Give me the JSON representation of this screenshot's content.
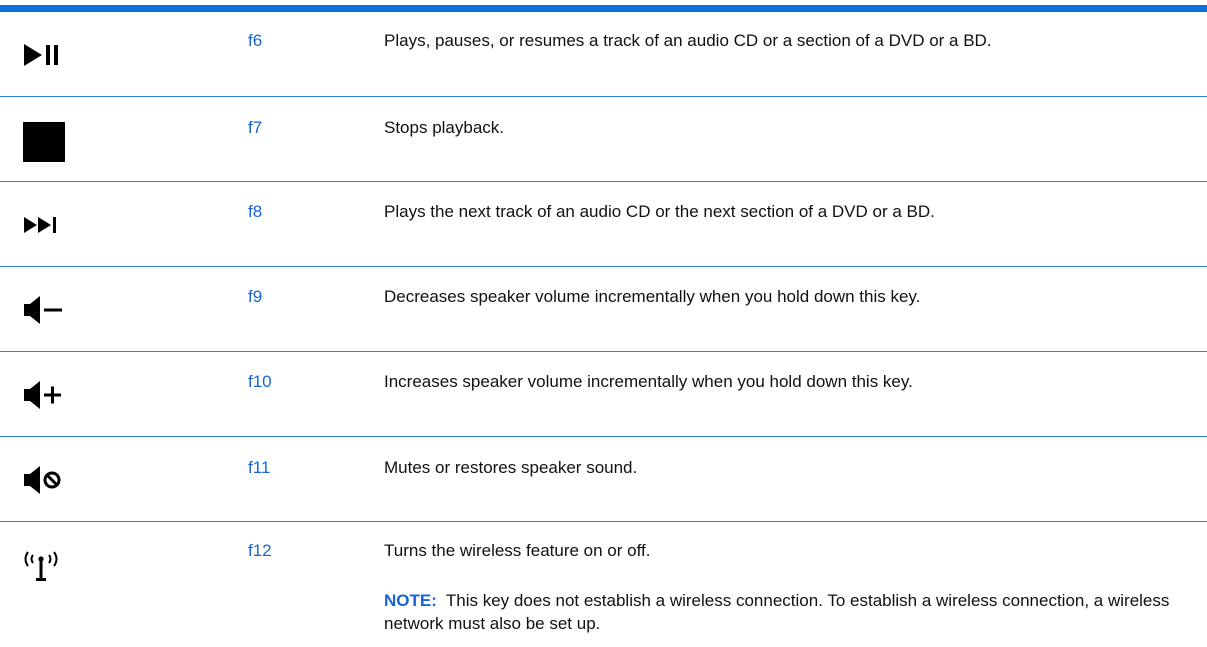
{
  "accent_color": "#1565d8",
  "rows": [
    {
      "icon": "play-pause-icon",
      "key": "f6",
      "description": "Plays, pauses, or resumes a track of an audio CD or a section of a DVD or a BD."
    },
    {
      "icon": "stop-icon",
      "key": "f7",
      "description": "Stops playback."
    },
    {
      "icon": "next-track-icon",
      "key": "f8",
      "description": "Plays the next track of an audio CD or the next section of a DVD or a BD."
    },
    {
      "icon": "volume-down-icon",
      "key": "f9",
      "description": "Decreases speaker volume incrementally when you hold down this key."
    },
    {
      "icon": "volume-up-icon",
      "key": "f10",
      "description": "Increases speaker volume incrementally when you hold down this key."
    },
    {
      "icon": "mute-icon",
      "key": "f11",
      "description": "Mutes or restores speaker sound."
    },
    {
      "icon": "wireless-icon",
      "key": "f12",
      "description": "Turns the wireless feature on or off.",
      "note_label": "NOTE:",
      "note_text": "This key does not establish a wireless connection. To establish a wireless connection, a wireless network must also be set up."
    }
  ]
}
